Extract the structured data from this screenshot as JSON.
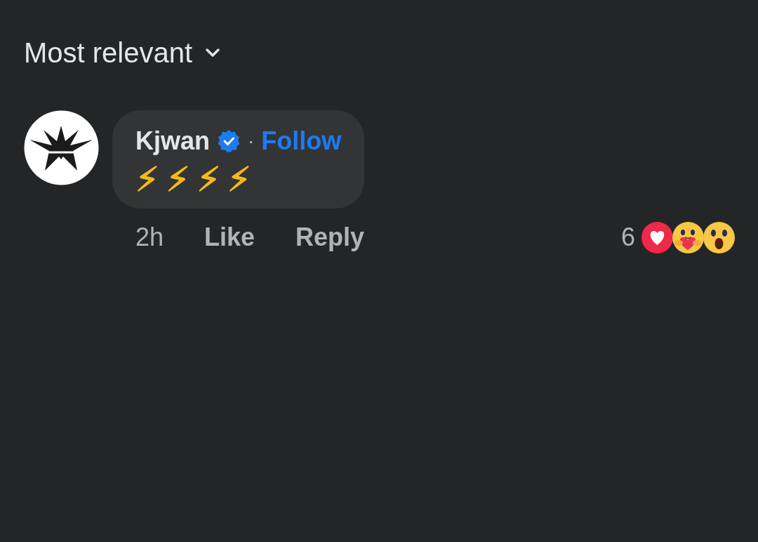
{
  "sort": {
    "label": "Most relevant"
  },
  "comment": {
    "author": "Kjwan",
    "verified": true,
    "separator": "·",
    "follow": "Follow",
    "body": "⚡⚡⚡⚡",
    "time": "2h",
    "actions": [
      "Like",
      "Reply"
    ],
    "reaction_count": "6",
    "reactions": [
      {
        "kind": "love"
      },
      {
        "kind": "care"
      },
      {
        "kind": "wow"
      }
    ]
  }
}
